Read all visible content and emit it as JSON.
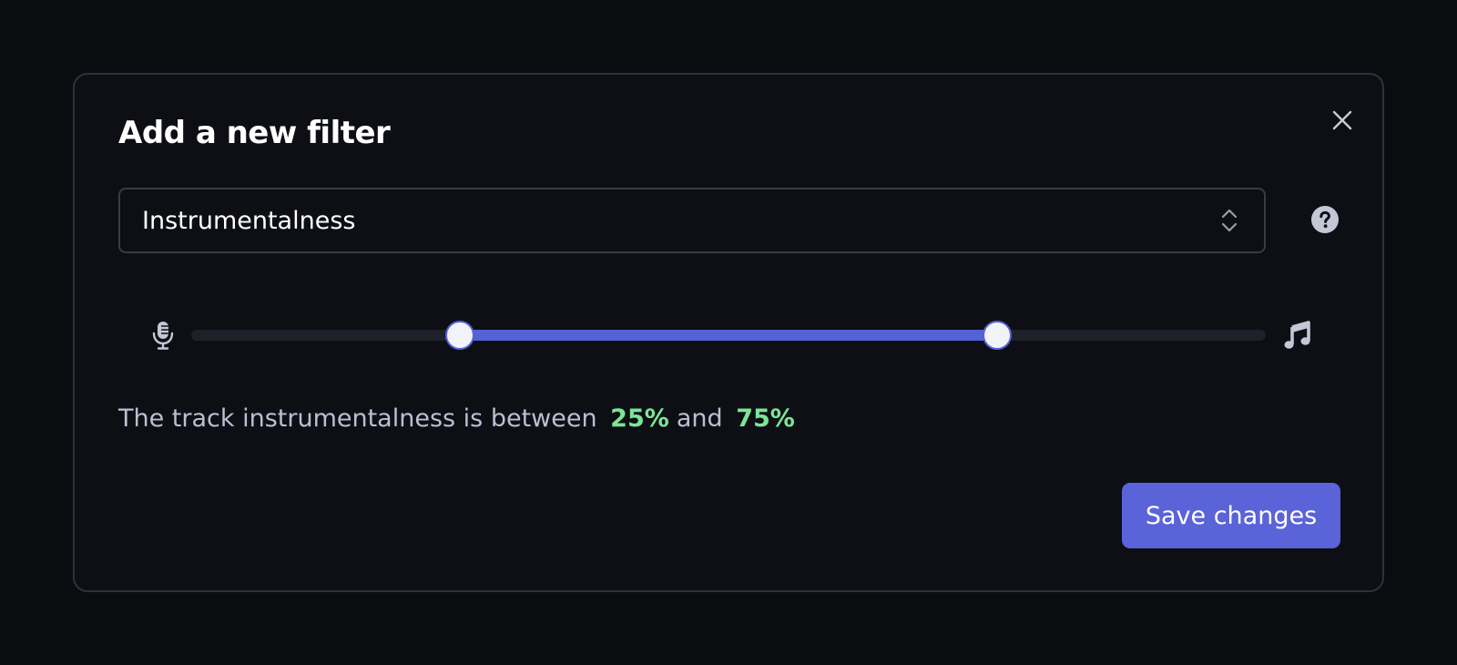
{
  "dialog": {
    "title": "Add a new filter",
    "close_icon": "close-icon",
    "help_icon": "help-circle-icon"
  },
  "filter_select": {
    "selected": "Instrumentalness",
    "icon": "chevron-up-down-icon"
  },
  "range_slider": {
    "min_icon": "microphone-icon",
    "max_icon": "music-note-icon",
    "low_value": 0.25,
    "high_value": 0.75,
    "accent_color": "#5462d6"
  },
  "summary": {
    "prefix": "The track instrumentalness is between",
    "low_label": "25%",
    "middle": "and",
    "high_label": "75%",
    "value_color": "#7be596"
  },
  "actions": {
    "save_label": "Save changes",
    "save_color": "#5a63d8"
  }
}
